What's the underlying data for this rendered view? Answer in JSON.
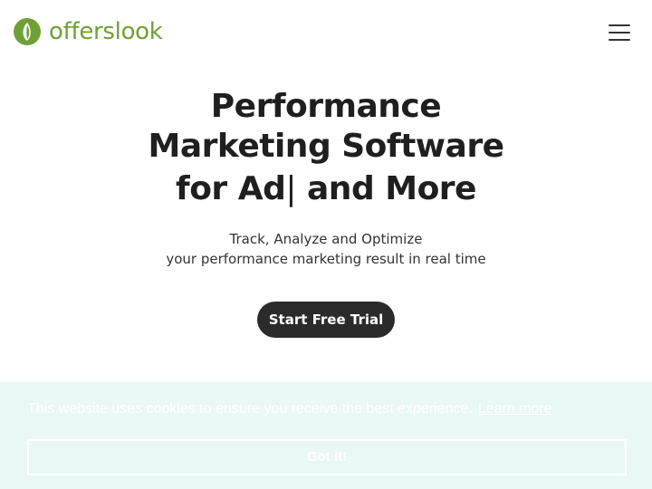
{
  "brand": {
    "name": "offerslook",
    "logo_icon": "leaf-logo-icon",
    "color": "#6fa035"
  },
  "header": {
    "menu_icon": "hamburger-menu-icon"
  },
  "hero": {
    "title_line1": "Performance",
    "title_line2": "Marketing Software",
    "title_line3_prefix": "for Ad",
    "title_caret": "|",
    "title_line3_suffix": " and More",
    "subtitle_line1": "Track, Analyze and Optimize",
    "subtitle_line2": "your performance marketing result in real time",
    "cta_label": "Start Free Trial",
    "cta_color": "#2b2b2b"
  },
  "cookie_banner": {
    "message": "This website uses cookies to ensure you receive the best experience.",
    "link_label": "Learn more",
    "accept_label": "Got it!",
    "background": "#eaf7f7"
  }
}
